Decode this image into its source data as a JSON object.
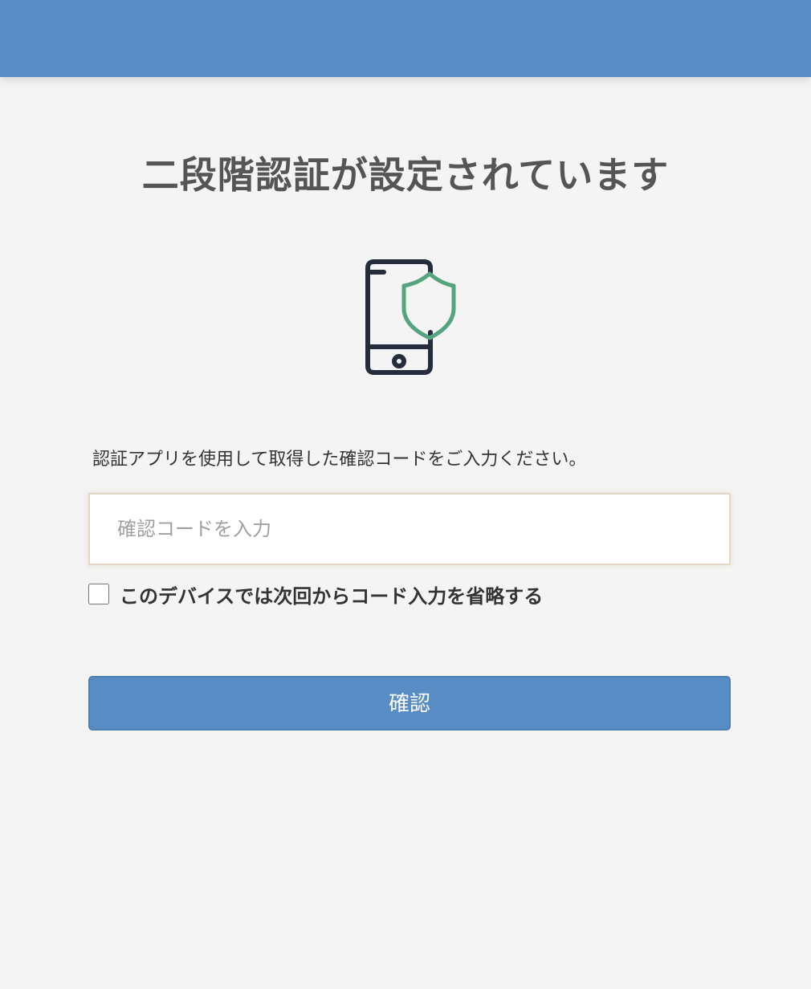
{
  "header": {
    "color": "#588cc5"
  },
  "page": {
    "title": "二段階認証が設定されています"
  },
  "hero_icon": {
    "name": "phone-shield-icon",
    "phone_color": "#252c3a",
    "shield_color": "#55a47f"
  },
  "form": {
    "instruction": "認証アプリを使用して取得した確認コードをご入力ください。",
    "code_value": "",
    "code_placeholder": "確認コードを入力",
    "remember_checked": false,
    "remember_label": "このデバイスでは次回からコード入力を省略する",
    "submit_label": "確認"
  }
}
